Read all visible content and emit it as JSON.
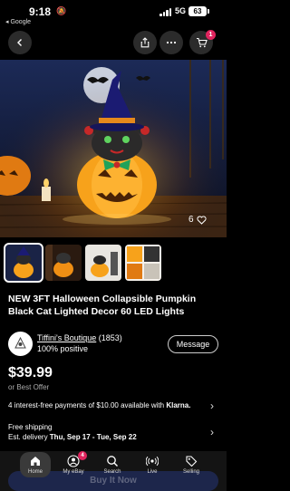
{
  "status_bar": {
    "time": "9:18",
    "back_app": "◂ Google",
    "network": "5G",
    "battery": "63"
  },
  "nav": {
    "cart_count": "1"
  },
  "gallery": {
    "photo_count": "6"
  },
  "listing": {
    "title": "NEW 3FT Halloween Collapsible Pumpkin Black Cat Lighted Decor 60 LED Lights"
  },
  "seller": {
    "name": "Tiffini's Boutique",
    "feedback_count": "(1853)",
    "positive": "100% positive",
    "message_label": "Message"
  },
  "price": {
    "amount": "$39.99",
    "best_offer": "or Best Offer"
  },
  "installments": {
    "text": "4 interest-free payments of $10.00 available with ",
    "provider": "Klarna."
  },
  "shipping": {
    "label": "Free shipping",
    "delivery_prefix": "Est. delivery ",
    "delivery_dates": "Thu, Sep 17 - Tue, Sep 22"
  },
  "buy_now_label": "Buy It Now",
  "bottom_nav": {
    "items": [
      {
        "label": "Home"
      },
      {
        "label": "My eBay"
      },
      {
        "label": "Search"
      },
      {
        "label": "Live"
      },
      {
        "label": "Selling"
      }
    ],
    "my_ebay_badge": "4"
  },
  "colors": {
    "background": "#000000",
    "badge": "#e0245e",
    "pumpkin": "#f7a21b"
  }
}
